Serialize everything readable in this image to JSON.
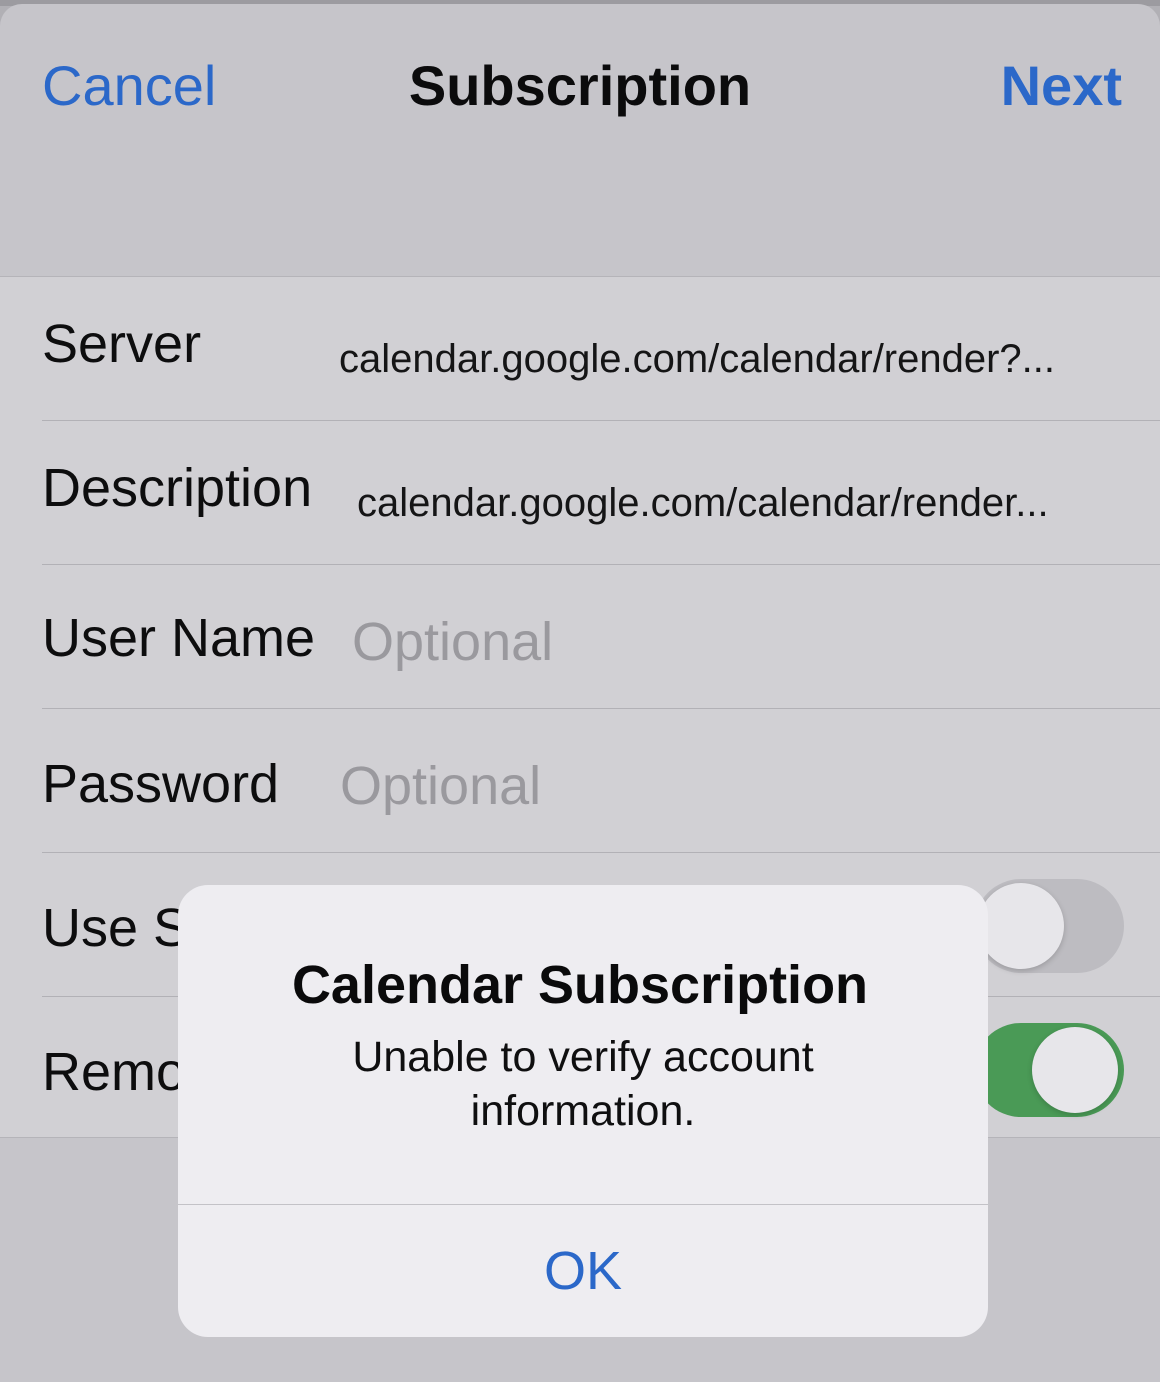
{
  "nav": {
    "cancel_label": "Cancel",
    "title": "Subscription",
    "next_label": "Next"
  },
  "form": {
    "server": {
      "label": "Server",
      "value": "calendar.google.com/calendar/render?..."
    },
    "description": {
      "label": "Description",
      "value": "calendar.google.com/calendar/render..."
    },
    "username": {
      "label": "User Name",
      "placeholder": "Optional"
    },
    "password": {
      "label": "Password",
      "placeholder": "Optional"
    },
    "use_ssl": {
      "label_visible": "Use S",
      "on": false
    },
    "remove_alarms": {
      "label_visible": "Remo",
      "on": true
    }
  },
  "alert": {
    "title": "Calendar Subscription",
    "message": "Unable to verify account information.",
    "ok_label": "OK"
  },
  "colors": {
    "accent": "#2b68c9",
    "toggle_on": "#4a9a56",
    "placeholder": "#9a999e"
  }
}
